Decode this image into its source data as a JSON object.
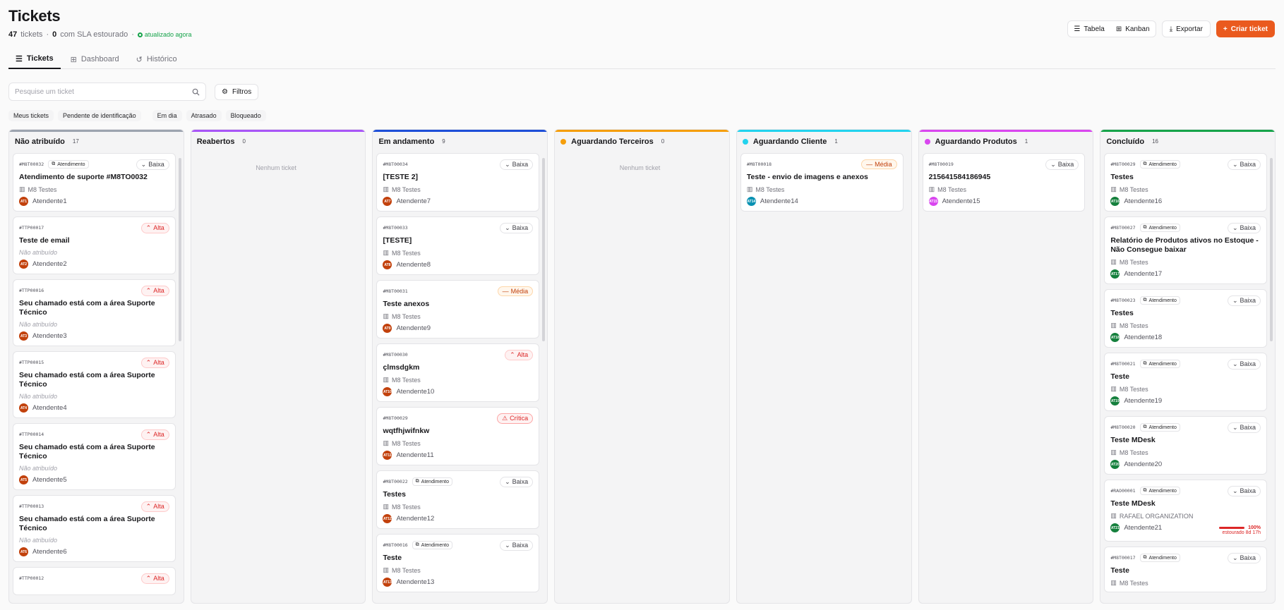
{
  "header": {
    "title": "Tickets",
    "count": "47",
    "count_label": "tickets",
    "sla_count": "0",
    "sla_label": "com SLA estourado",
    "live": "atualizado agora"
  },
  "view": {
    "table": "Tabela",
    "kanban": "Kanban",
    "export": "Exportar",
    "create": "Criar ticket"
  },
  "tabs": [
    "Tickets",
    "Dashboard",
    "Histórico"
  ],
  "search": {
    "placeholder": "Pesquise um ticket",
    "filters": "Filtros"
  },
  "chips": [
    "Meus tickets",
    "Pendente de identificação",
    "Em dia",
    "Atrasado",
    "Bloqueado"
  ],
  "colors": {
    "accent": "#ea5a1e",
    "unassigned": "#9ca3af",
    "reopened": "#a855f7",
    "progress": "#1d4ed8",
    "third": "#f59e0b",
    "client": "#22d3ee",
    "products": "#d946ef",
    "done": "#16a34a"
  },
  "columns": [
    {
      "name": "Não atribuído",
      "count": "17",
      "color": "#9ca3af",
      "dot": false,
      "empty": "",
      "cards": [
        {
          "code": "#M8T00032",
          "tag": "Atendimento",
          "priority": "Baixa",
          "p": "baixa",
          "title": "Atendimento de suporte #M8TO0032",
          "org": "M8 Testes",
          "unassigned": false,
          "av": "AT1",
          "avc": "#c2410c",
          "assignee": "Atendente1"
        },
        {
          "code": "#TTP00017",
          "tag": "",
          "priority": "Alta",
          "p": "alta",
          "title": "Teste de email",
          "org": "Não atribuído",
          "unassigned": true,
          "av": "AT2",
          "avc": "#c2410c",
          "assignee": "Atendente2"
        },
        {
          "code": "#TTP00016",
          "tag": "",
          "priority": "Alta",
          "p": "alta",
          "title": "Seu chamado está com a área Suporte Técnico",
          "org": "Não atribuído",
          "unassigned": true,
          "av": "AT3",
          "avc": "#c2410c",
          "assignee": "Atendente3"
        },
        {
          "code": "#TTP00015",
          "tag": "",
          "priority": "Alta",
          "p": "alta",
          "title": "Seu chamado está com a área Suporte Técnico",
          "org": "Não atribuído",
          "unassigned": true,
          "av": "AT4",
          "avc": "#c2410c",
          "assignee": "Atendente4"
        },
        {
          "code": "#TTP00014",
          "tag": "",
          "priority": "Alta",
          "p": "alta",
          "title": "Seu chamado está com a área Suporte Técnico",
          "org": "Não atribuído",
          "unassigned": true,
          "av": "AT5",
          "avc": "#c2410c",
          "assignee": "Atendente5"
        },
        {
          "code": "#TTP00013",
          "tag": "",
          "priority": "Alta",
          "p": "alta",
          "title": "Seu chamado está com a área Suporte Técnico",
          "org": "Não atribuído",
          "unassigned": true,
          "av": "AT6",
          "avc": "#c2410c",
          "assignee": "Atendente6"
        },
        {
          "code": "#TTP00012",
          "tag": "",
          "priority": "Alta",
          "p": "alta",
          "title": "",
          "org": "",
          "unassigned": false,
          "av": "",
          "avc": "",
          "assignee": ""
        }
      ]
    },
    {
      "name": "Reabertos",
      "count": "0",
      "color": "#a855f7",
      "dot": false,
      "empty": "Nenhum ticket",
      "cards": []
    },
    {
      "name": "Em andamento",
      "count": "9",
      "color": "#1d4ed8",
      "dot": false,
      "empty": "",
      "cards": [
        {
          "code": "#M8T00034",
          "tag": "",
          "priority": "Baixa",
          "p": "baixa",
          "title": "[TESTE 2]",
          "org": "M8 Testes",
          "unassigned": false,
          "av": "AT7",
          "avc": "#c2410c",
          "assignee": "Atendente7"
        },
        {
          "code": "#M8T00033",
          "tag": "",
          "priority": "Baixa",
          "p": "baixa",
          "title": "[TESTE]",
          "org": "M8 Testes",
          "unassigned": false,
          "av": "AT8",
          "avc": "#c2410c",
          "assignee": "Atendente8"
        },
        {
          "code": "#M8T00031",
          "tag": "",
          "priority": "Média",
          "p": "media",
          "title": "Teste anexos",
          "org": "M8 Testes",
          "unassigned": false,
          "av": "AT9",
          "avc": "#c2410c",
          "assignee": "Atendente9"
        },
        {
          "code": "#M8T00030",
          "tag": "",
          "priority": "Alta",
          "p": "alta",
          "title": "çlmsdgkm",
          "org": "M8 Testes",
          "unassigned": false,
          "av": "AT10",
          "avc": "#c2410c",
          "assignee": "Atendente10"
        },
        {
          "code": "#M8T00029",
          "tag": "",
          "priority": "Crítica",
          "p": "critica",
          "title": "wqtfhjwifnkw",
          "org": "M8 Testes",
          "unassigned": false,
          "av": "AT11",
          "avc": "#c2410c",
          "assignee": "Atendente11"
        },
        {
          "code": "#M8T00022",
          "tag": "Atendimento",
          "priority": "Baixa",
          "p": "baixa",
          "title": "Testes",
          "org": "M8 Testes",
          "unassigned": false,
          "av": "AT12",
          "avc": "#c2410c",
          "assignee": "Atendente12"
        },
        {
          "code": "#M8T00016",
          "tag": "Atendimento",
          "priority": "Baixa",
          "p": "baixa",
          "title": "Teste",
          "org": "M8 Testes",
          "unassigned": false,
          "av": "AT13",
          "avc": "#c2410c",
          "assignee": "Atendente13"
        }
      ]
    },
    {
      "name": "Aguardando Terceiros",
      "count": "0",
      "color": "#f59e0b",
      "dot": true,
      "empty": "Nenhum ticket",
      "cards": []
    },
    {
      "name": "Aguardando Cliente",
      "count": "1",
      "color": "#22d3ee",
      "dot": true,
      "empty": "",
      "cards": [
        {
          "code": "#M8T00018",
          "tag": "",
          "priority": "Média",
          "p": "media",
          "title": "Teste - envio de imagens e anexos",
          "org": "M8 Testes",
          "unassigned": false,
          "av": "AT14",
          "avc": "#0891b2",
          "assignee": "Atendente14"
        }
      ]
    },
    {
      "name": "Aguardando Produtos",
      "count": "1",
      "color": "#d946ef",
      "dot": true,
      "empty": "",
      "cards": [
        {
          "code": "#M8T00019",
          "tag": "",
          "priority": "Baixa",
          "p": "baixa",
          "title": "215641584186945",
          "org": "M8 Testes",
          "unassigned": false,
          "av": "AT15",
          "avc": "#d946ef",
          "assignee": "Atendente15"
        }
      ]
    },
    {
      "name": "Concluído",
      "count": "16",
      "color": "#16a34a",
      "dot": false,
      "empty": "",
      "cards": [
        {
          "code": "#M8T00029",
          "tag": "Atendimento",
          "priority": "Baixa",
          "p": "baixa",
          "title": "Testes",
          "org": "M8 Testes",
          "unassigned": false,
          "av": "AT16",
          "avc": "#15803d",
          "assignee": "Atendente16"
        },
        {
          "code": "#M8T00027",
          "tag": "Atendimento",
          "priority": "Baixa",
          "p": "baixa",
          "title": "Relatório de Produtos ativos no Estoque - Não Consegue baixar",
          "org": "M8 Testes",
          "unassigned": false,
          "av": "AT17",
          "avc": "#15803d",
          "assignee": "Atendente17"
        },
        {
          "code": "#M8T00023",
          "tag": "Atendimento",
          "priority": "Baixa",
          "p": "baixa",
          "title": "Testes",
          "org": "M8 Testes",
          "unassigned": false,
          "av": "AT18",
          "avc": "#15803d",
          "assignee": "Atendente18"
        },
        {
          "code": "#M8T00021",
          "tag": "Atendimento",
          "priority": "Baixa",
          "p": "baixa",
          "title": "Teste",
          "org": "M8 Testes",
          "unassigned": false,
          "av": "AT19",
          "avc": "#15803d",
          "assignee": "Atendente19"
        },
        {
          "code": "#M8T00020",
          "tag": "Atendimento",
          "priority": "Baixa",
          "p": "baixa",
          "title": "Teste MDesk",
          "org": "M8 Testes",
          "unassigned": false,
          "av": "AT20",
          "avc": "#15803d",
          "assignee": "Atendente20"
        },
        {
          "code": "#RAO00001",
          "tag": "Atendimento",
          "priority": "Baixa",
          "p": "baixa",
          "title": "Teste MDesk",
          "org": "RAFAEL ORGANIZATION",
          "unassigned": false,
          "av": "AT21",
          "avc": "#15803d",
          "assignee": "Atendente21",
          "sla_pct": "100%",
          "sla_text": "estourado 8d 17h"
        },
        {
          "code": "#M8T00017",
          "tag": "Atendimento",
          "priority": "Baixa",
          "p": "baixa",
          "title": "Teste",
          "org": "M8 Testes",
          "unassigned": false,
          "av": "",
          "avc": "",
          "assignee": ""
        }
      ]
    }
  ]
}
